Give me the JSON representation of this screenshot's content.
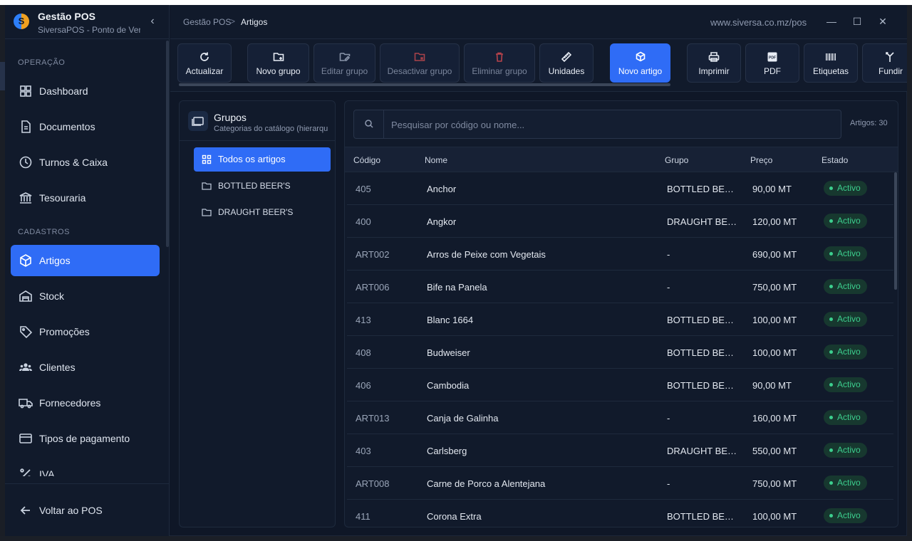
{
  "app": {
    "title": "Gestão POS",
    "subtitle": "SiversaPOS - Ponto de Venda",
    "url": "www.siversa.co.mz/pos"
  },
  "breadcrumb": {
    "root": "Gestão POS",
    "sep": ">",
    "current": "Artigos"
  },
  "window": {
    "minimize": "—",
    "maximize": "☐",
    "close": "✕"
  },
  "sidebar": {
    "collapse": "‹",
    "sections": {
      "operacao": "OPERAÇÃO",
      "cadastros": "CADASTROS"
    },
    "items": [
      {
        "label": "Dashboard",
        "icon": "dashboard-icon"
      },
      {
        "label": "Documentos",
        "icon": "document-icon"
      },
      {
        "label": "Turnos & Caixa",
        "icon": "clock-icon"
      },
      {
        "label": "Tesouraria",
        "icon": "bank-icon"
      },
      {
        "label": "Artigos",
        "icon": "box-icon",
        "active": true
      },
      {
        "label": "Stock",
        "icon": "warehouse-icon"
      },
      {
        "label": "Promoções",
        "icon": "tag-icon"
      },
      {
        "label": "Clientes",
        "icon": "users-icon"
      },
      {
        "label": "Fornecedores",
        "icon": "truck-icon"
      },
      {
        "label": "Tipos de pagamento",
        "icon": "card-icon"
      },
      {
        "label": "IVA",
        "icon": "percent-icon"
      }
    ],
    "back": "Voltar ao POS"
  },
  "toolbar": [
    {
      "label": "Actualizar",
      "icon": "refresh-icon"
    },
    {
      "label": "Novo grupo",
      "icon": "folder-plus-icon"
    },
    {
      "label": "Editar grupo",
      "icon": "folder-edit-icon",
      "disabled": true
    },
    {
      "label": "Desactivar grupo",
      "icon": "folder-x-icon",
      "disabled": true
    },
    {
      "label": "Eliminar grupo",
      "icon": "trash-icon",
      "disabled": true
    },
    {
      "label": "Unidades",
      "icon": "ruler-icon"
    },
    {
      "label": "Novo artigo",
      "icon": "box-plus-icon",
      "primary": true
    },
    {
      "label": "Imprimir",
      "icon": "printer-icon"
    },
    {
      "label": "PDF",
      "icon": "pdf-icon"
    },
    {
      "label": "Etiquetas",
      "icon": "barcode-icon"
    },
    {
      "label": "Fundir",
      "icon": "merge-icon"
    }
  ],
  "groups": {
    "title": "Grupos",
    "subtitle": "Categorias do catálogo (hierarquia)",
    "items": [
      {
        "label": "Todos os artigos",
        "active": true
      },
      {
        "label": "BOTTLED BEER'S"
      },
      {
        "label": "DRAUGHT BEER'S"
      }
    ]
  },
  "articles": {
    "search_placeholder": "Pesquisar por código ou nome...",
    "count": "Artigos: 30",
    "columns": {
      "code": "Código",
      "name": "Nome",
      "group": "Grupo",
      "price": "Preço",
      "status": "Estado"
    },
    "rows": [
      {
        "code": "405",
        "name": "Anchor",
        "group": "BOTTLED BEER'S",
        "price": "90,00 MT",
        "status": "Activo"
      },
      {
        "code": "400",
        "name": "Angkor",
        "group": "DRAUGHT BEER'S",
        "price": "120,00 MT",
        "status": "Activo"
      },
      {
        "code": "ART002",
        "name": "Arros de Peixe com Vegetais",
        "group": "-",
        "price": "690,00 MT",
        "status": "Activo"
      },
      {
        "code": "ART006",
        "name": "Bife na Panela",
        "group": "-",
        "price": "750,00 MT",
        "status": "Activo"
      },
      {
        "code": "413",
        "name": "Blanc 1664",
        "group": "BOTTLED BEER'S",
        "price": "100,00 MT",
        "status": "Activo"
      },
      {
        "code": "408",
        "name": "Budweiser",
        "group": "BOTTLED BEER'S",
        "price": "100,00 MT",
        "status": "Activo"
      },
      {
        "code": "406",
        "name": "Cambodia",
        "group": "BOTTLED BEER'S",
        "price": "90,00 MT",
        "status": "Activo"
      },
      {
        "code": "ART013",
        "name": "Canja de Galinha",
        "group": "-",
        "price": "160,00 MT",
        "status": "Activo"
      },
      {
        "code": "403",
        "name": "Carlsberg",
        "group": "DRAUGHT BEER'S",
        "price": "550,00 MT",
        "status": "Activo"
      },
      {
        "code": "ART008",
        "name": "Carne de Porco a Alentejana",
        "group": "-",
        "price": "750,00 MT",
        "status": "Activo"
      },
      {
        "code": "411",
        "name": "Corona Extra",
        "group": "BOTTLED BEER'S",
        "price": "100,00 MT",
        "status": "Activo"
      }
    ]
  },
  "colors": {
    "accent": "#2f6cf6",
    "status_active": "#3ccf8e",
    "background": "#0f1727"
  }
}
